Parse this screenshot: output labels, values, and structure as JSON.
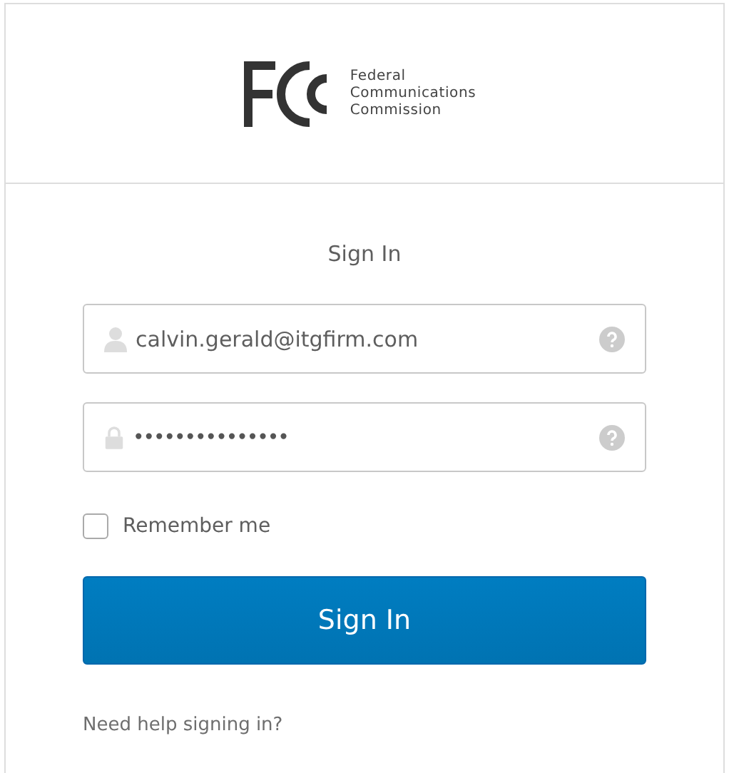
{
  "header": {
    "agency_name": [
      "Federal",
      "Communications",
      "Commission"
    ]
  },
  "form": {
    "title": "Sign In",
    "fields": [
      {
        "kind": "user",
        "value": "calvin.gerald@itgfirm.com"
      },
      {
        "kind": "password",
        "value": "•••••••••••••••"
      }
    ],
    "remember": {
      "label": "Remember me",
      "checked": false
    },
    "submit": "Sign In",
    "help_link": "Need help signing in?"
  }
}
